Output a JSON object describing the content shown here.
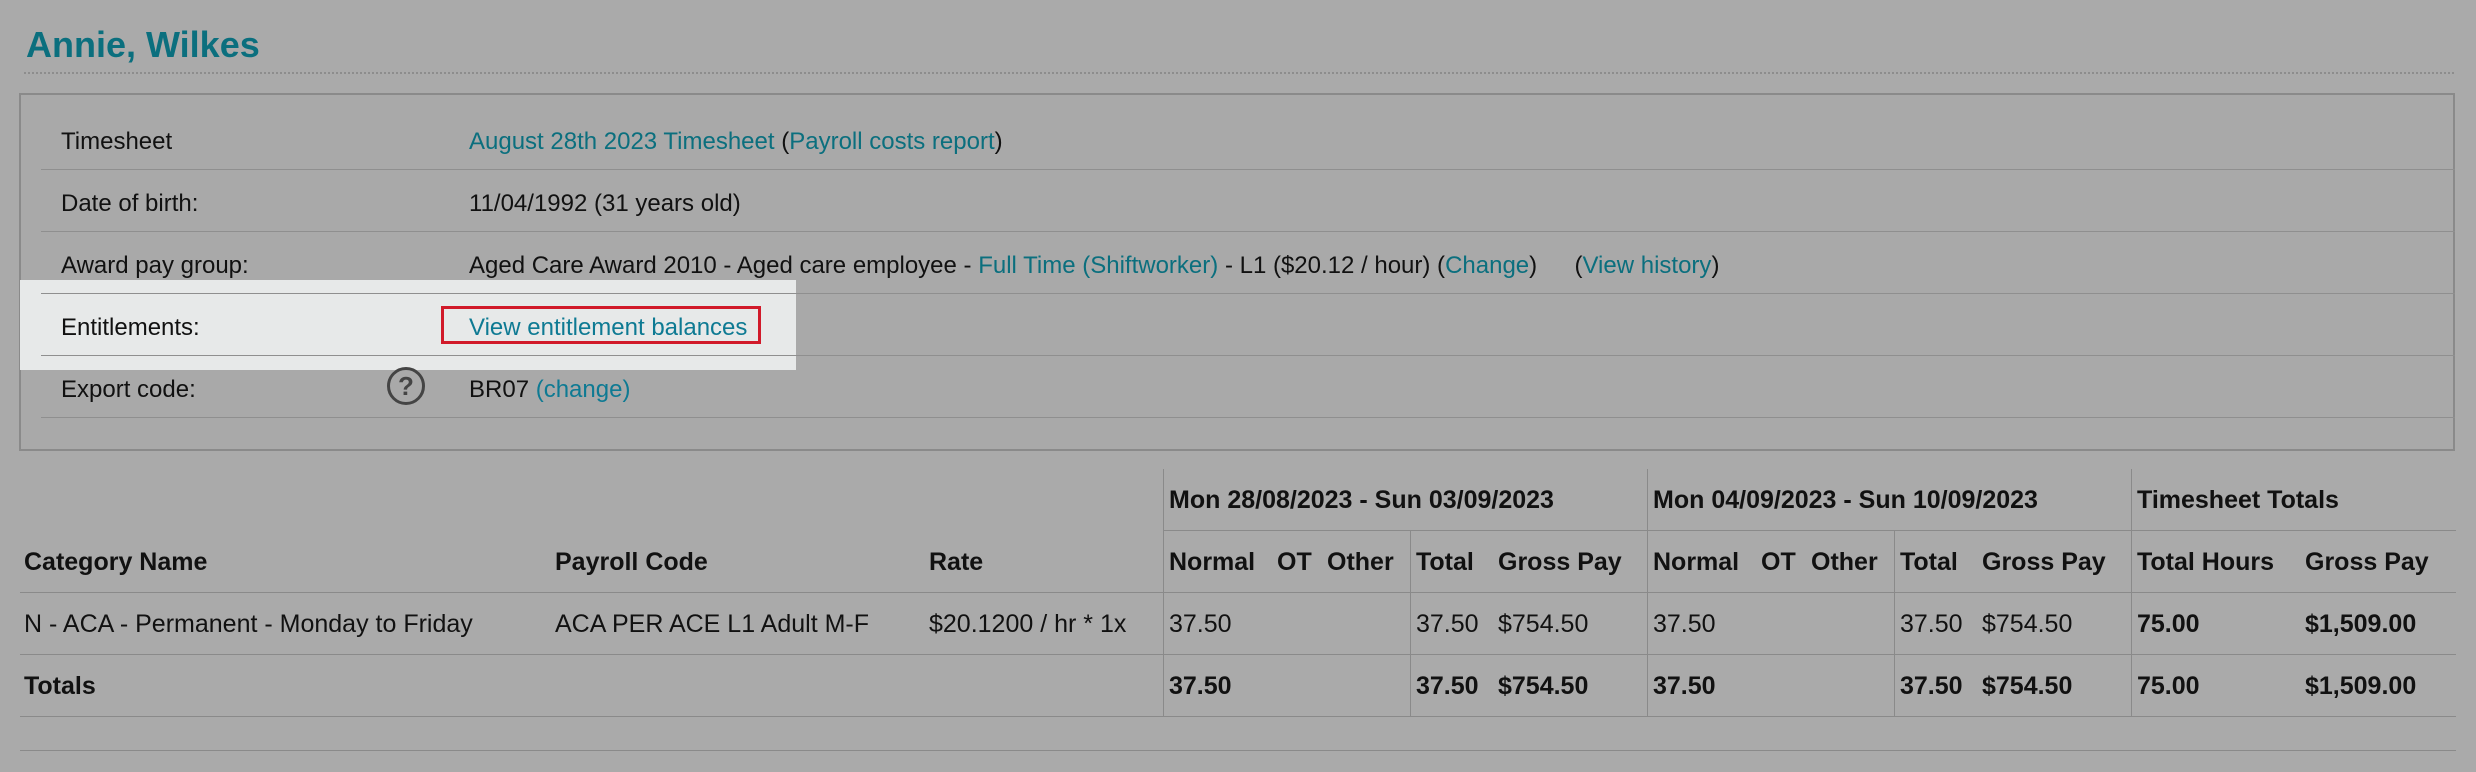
{
  "employee_name": "Annie, Wilkes",
  "info": {
    "timesheet_label": "Timesheet",
    "timesheet_link": "August 28th 2023 Timesheet",
    "timesheet_open": "(",
    "payroll_link": "Payroll costs report",
    "timesheet_close": ")",
    "dob_label": "Date of birth:",
    "dob_value": "11/04/1992 (31 years old)",
    "award_label": "Award pay group:",
    "award_prefix": "Aged Care Award 2010 - Aged care employee -",
    "award_link": "Full Time (Shiftworker)",
    "award_mid": "- L1 ($20.12 / hour) (",
    "award_change": "Change",
    "award_close": ")",
    "history_open": "(",
    "history_link": "View history",
    "history_close": ")",
    "entitlements_label": "Entitlements:",
    "entitlements_link": "View entitlement balances",
    "export_label": "Export code:",
    "export_value": "BR07",
    "export_change": "(change)",
    "help_icon": "?"
  },
  "table": {
    "week1": "Mon 28/08/2023 - Sun 03/09/2023",
    "week2": "Mon 04/09/2023 - Sun 10/09/2023",
    "totals_group": "Timesheet Totals",
    "headers": {
      "category": "Category Name",
      "payroll": "Payroll Code",
      "rate": "Rate",
      "normal": "Normal",
      "ot": "OT",
      "other": "Other",
      "total": "Total",
      "gross": "Gross Pay",
      "total_hours": "Total Hours"
    },
    "row": {
      "category": "N - ACA - Permanent - Monday to Friday",
      "payroll": "ACA PER ACE L1 Adult M-F",
      "rate": "$20.1200 / hr * 1x",
      "w1_normal": "37.50",
      "w1_total": "37.50",
      "w1_gross": "$754.50",
      "w2_normal": "37.50",
      "w2_total": "37.50",
      "w2_gross": "$754.50",
      "total_hours": "75.00",
      "gross": "$1,509.00"
    },
    "totals": {
      "label": "Totals",
      "w1_normal": "37.50",
      "w1_total": "37.50",
      "w1_gross": "$754.50",
      "w2_normal": "37.50",
      "w2_total": "37.50",
      "w2_gross": "$754.50",
      "total_hours": "75.00",
      "gross": "$1,509.00"
    }
  }
}
